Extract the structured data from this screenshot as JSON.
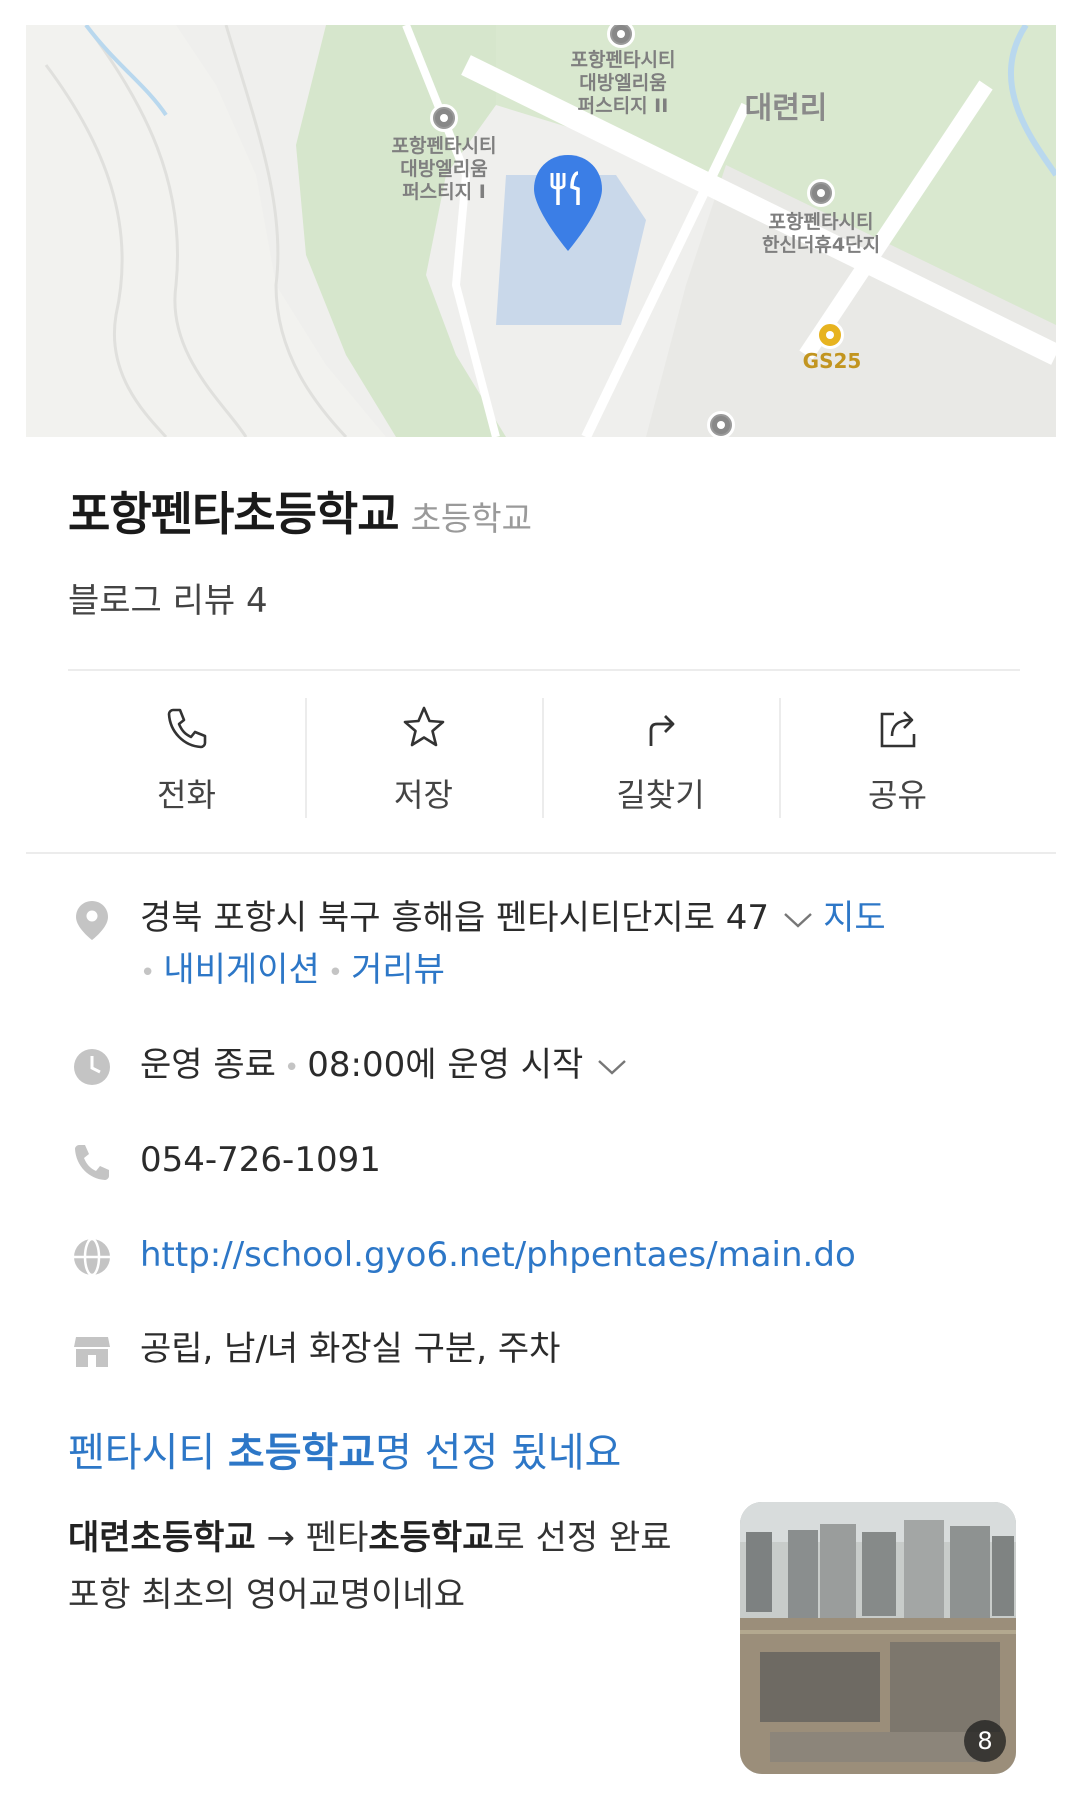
{
  "map": {
    "labels": {
      "apt2": "포항펜타시티\n대방엘리움\n퍼스티지 II",
      "apt1": "포항펜타시티\n대방엘리움\n퍼스티지 I",
      "area": "대련리",
      "hanshin": "포항펜타시티\n한신더휴4단지",
      "gs": "GS25"
    },
    "pin_icon": "restaurant-pin-icon",
    "pin_color": "#3b7ee6"
  },
  "place": {
    "name": "포항펜타초등학교",
    "category": "초등학교",
    "review": "블로그 리뷰 4"
  },
  "actions": [
    {
      "label": "전화",
      "icon": "phone-icon"
    },
    {
      "label": "저장",
      "icon": "star-icon"
    },
    {
      "label": "길찾기",
      "icon": "directions-icon"
    },
    {
      "label": "공유",
      "icon": "share-icon"
    }
  ],
  "info": {
    "address": "경북 포항시 북구 흥해읍 펜타시티단지로 47",
    "address_links": {
      "map": "지도",
      "navigation": "내비게이션",
      "streetview": "거리뷰"
    },
    "hours_status": "운영 종료",
    "hours_next": "08:00에 운영 시작",
    "phone": "054-726-1091",
    "website": "http://school.gyo6.net/phpentaes/main.do",
    "facilities": "공립, 남/녀 화장실 구분, 주차"
  },
  "blog": {
    "title_pre": "펜타시티 ",
    "title_bold": "초등학교",
    "title_post": "명 선정 됬네요",
    "body_b1": "대련초등학교",
    "body_t1": " → 펜타",
    "body_b2": "초등학교",
    "body_t2": "로 선정 완료 포항 최초의 영어교명이네요",
    "photo_count": "8"
  },
  "colors": {
    "link": "#2d77c7",
    "text": "#222222",
    "muted": "#9a9a9a",
    "divider": "#ececec",
    "pin": "#3b7ee6"
  }
}
